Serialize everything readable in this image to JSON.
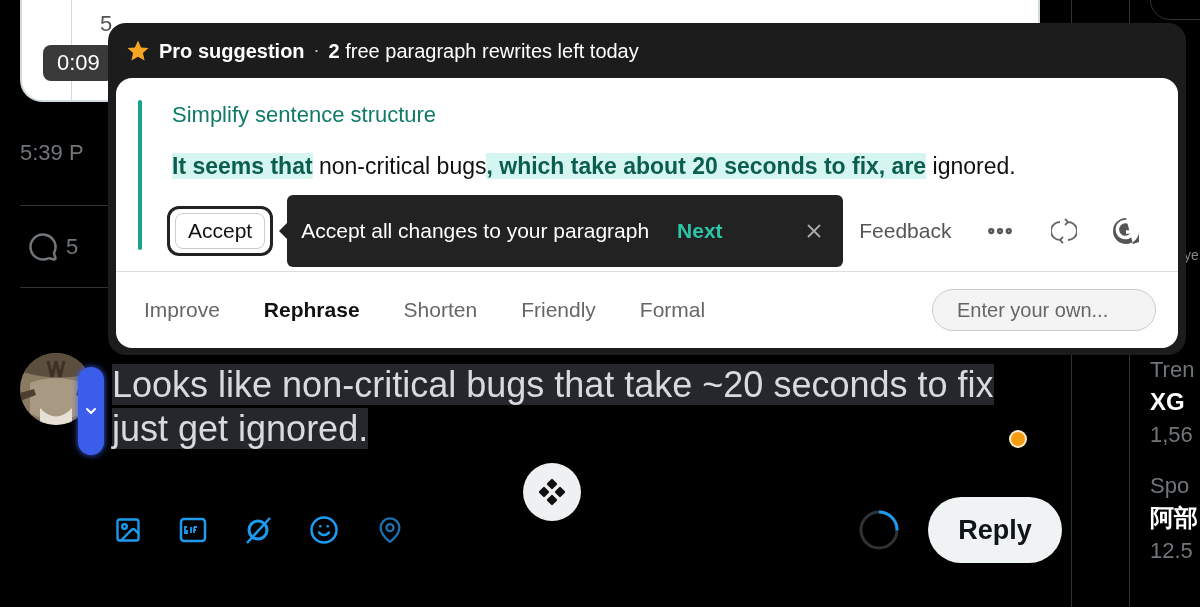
{
  "video_card": {
    "line_number": "5",
    "timestamp": "0:09"
  },
  "tweet_time": "5:39 P",
  "reply_count": "5",
  "popup": {
    "header": {
      "title": "Pro suggestion",
      "separator": "·",
      "note": "**2** free paragraph rewrites left today"
    },
    "suggestion": {
      "title": "Simplify sentence structure",
      "segments": [
        {
          "text": "It seems that",
          "changed": true
        },
        {
          "text": " non-critical bugs",
          "changed": false
        },
        {
          "text": ", which take about 20 seconds to fix, are",
          "changed": true
        },
        {
          "text": " ignored.",
          "changed": false
        }
      ]
    },
    "accept_button": "Accept",
    "tooltip": {
      "text": "Accept all changes to your paragraph",
      "next": "Next"
    },
    "feedback": "Feedback",
    "tabs": [
      {
        "label": "Improve",
        "selected": false
      },
      {
        "label": "Rephrase",
        "selected": true
      },
      {
        "label": "Shorten",
        "selected": false
      },
      {
        "label": "Friendly",
        "selected": false
      },
      {
        "label": "Formal",
        "selected": false
      }
    ],
    "custom_prompt": {
      "placeholder": "Enter your own..."
    }
  },
  "composer": {
    "text": "Looks like non-critical bugs that take ~20 seconds to fix just get ignored.",
    "progress": {
      "level": 0.25
    },
    "reply_button": "Reply"
  },
  "sidebar": {
    "fragment": "ye",
    "items": [
      {
        "label": "Tren",
        "title": "XG",
        "meta": "1,56"
      },
      {
        "label": "Spo",
        "title": "阿部",
        "meta": "12.5"
      }
    ]
  }
}
